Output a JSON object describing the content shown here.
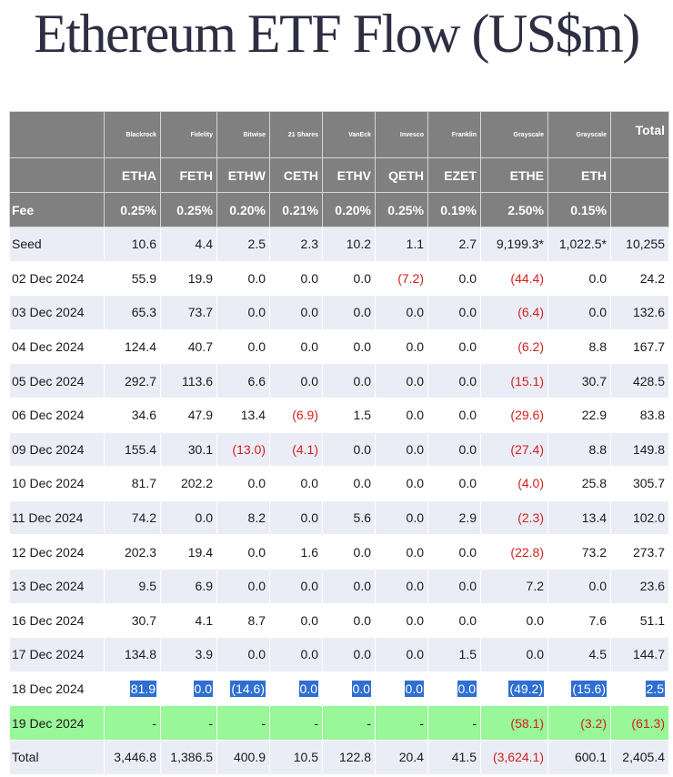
{
  "title": "Ethereum ETF Flow (US$m)",
  "colors": {
    "header_bg": "#808080",
    "row_alt": "#eaedf6",
    "negative": "#d2201c",
    "green_row": "#98f798",
    "selection": "#2f6fd1"
  },
  "issuers": [
    "Blackrock",
    "Fidelity",
    "Bitwise",
    "21 Shares",
    "VanEck",
    "Invesco",
    "Franklin",
    "Grayscale",
    "Grayscale"
  ],
  "total_label": "Total",
  "tickers": [
    "ETHA",
    "FETH",
    "ETHW",
    "CETH",
    "ETHV",
    "QETH",
    "EZET",
    "ETHE",
    "ETH"
  ],
  "fee_label": "Fee",
  "fees": [
    "0.25%",
    "0.25%",
    "0.20%",
    "0.21%",
    "0.20%",
    "0.25%",
    "0.19%",
    "2.50%",
    "0.15%"
  ],
  "rows": [
    {
      "date": "Seed",
      "values": [
        "10.6",
        "4.4",
        "2.5",
        "2.3",
        "10.2",
        "1.1",
        "2.7",
        "9,199.3*",
        "1,022.5*"
      ],
      "total": "10,255"
    },
    {
      "date": "02 Dec 2024",
      "values": [
        "55.9",
        "19.9",
        "0.0",
        "0.0",
        "0.0",
        "(7.2)",
        "0.0",
        "(44.4)",
        "0.0"
      ],
      "total": "24.2"
    },
    {
      "date": "03 Dec 2024",
      "values": [
        "65.3",
        "73.7",
        "0.0",
        "0.0",
        "0.0",
        "0.0",
        "0.0",
        "(6.4)",
        "0.0"
      ],
      "total": "132.6"
    },
    {
      "date": "04 Dec 2024",
      "values": [
        "124.4",
        "40.7",
        "0.0",
        "0.0",
        "0.0",
        "0.0",
        "0.0",
        "(6.2)",
        "8.8"
      ],
      "total": "167.7"
    },
    {
      "date": "05 Dec 2024",
      "values": [
        "292.7",
        "113.6",
        "6.6",
        "0.0",
        "0.0",
        "0.0",
        "0.0",
        "(15.1)",
        "30.7"
      ],
      "total": "428.5"
    },
    {
      "date": "06 Dec 2024",
      "values": [
        "34.6",
        "47.9",
        "13.4",
        "(6.9)",
        "1.5",
        "0.0",
        "0.0",
        "(29.6)",
        "22.9"
      ],
      "total": "83.8"
    },
    {
      "date": "09 Dec 2024",
      "values": [
        "155.4",
        "30.1",
        "(13.0)",
        "(4.1)",
        "0.0",
        "0.0",
        "0.0",
        "(27.4)",
        "8.8"
      ],
      "total": "149.8"
    },
    {
      "date": "10 Dec 2024",
      "values": [
        "81.7",
        "202.2",
        "0.0",
        "0.0",
        "0.0",
        "0.0",
        "0.0",
        "(4.0)",
        "25.8"
      ],
      "total": "305.7"
    },
    {
      "date": "11 Dec 2024",
      "values": [
        "74.2",
        "0.0",
        "8.2",
        "0.0",
        "5.6",
        "0.0",
        "2.9",
        "(2.3)",
        "13.4"
      ],
      "total": "102.0"
    },
    {
      "date": "12 Dec 2024",
      "values": [
        "202.3",
        "19.4",
        "0.0",
        "1.6",
        "0.0",
        "0.0",
        "0.0",
        "(22.8)",
        "73.2"
      ],
      "total": "273.7"
    },
    {
      "date": "13 Dec 2024",
      "values": [
        "9.5",
        "6.9",
        "0.0",
        "0.0",
        "0.0",
        "0.0",
        "0.0",
        "7.2",
        "0.0"
      ],
      "total": "23.6"
    },
    {
      "date": "16 Dec 2024",
      "values": [
        "30.7",
        "4.1",
        "8.7",
        "0.0",
        "0.0",
        "0.0",
        "0.0",
        "0.0",
        "7.6"
      ],
      "total": "51.1"
    },
    {
      "date": "17 Dec 2024",
      "values": [
        "134.8",
        "3.9",
        "0.0",
        "0.0",
        "0.0",
        "0.0",
        "1.5",
        "0.0",
        "4.5"
      ],
      "total": "144.7"
    },
    {
      "date": "18 Dec 2024",
      "values": [
        "81.9",
        "0.0",
        "(14.6)",
        "0.0",
        "0.0",
        "0.0",
        "0.0",
        "(49.2)",
        "(15.6)"
      ],
      "total": "2.5",
      "selected": true
    },
    {
      "date": "19 Dec 2024",
      "values": [
        "-",
        "-",
        "-",
        "-",
        "-",
        "-",
        "-",
        "(58.1)",
        "(3.2)"
      ],
      "total": "(61.3)",
      "green": true
    },
    {
      "date": "Total",
      "values": [
        "3,446.8",
        "1,386.5",
        "400.9",
        "10.5",
        "122.8",
        "20.4",
        "41.5",
        "(3,624.1)",
        "600.1"
      ],
      "total": "2,405.4",
      "is_total": true
    }
  ]
}
